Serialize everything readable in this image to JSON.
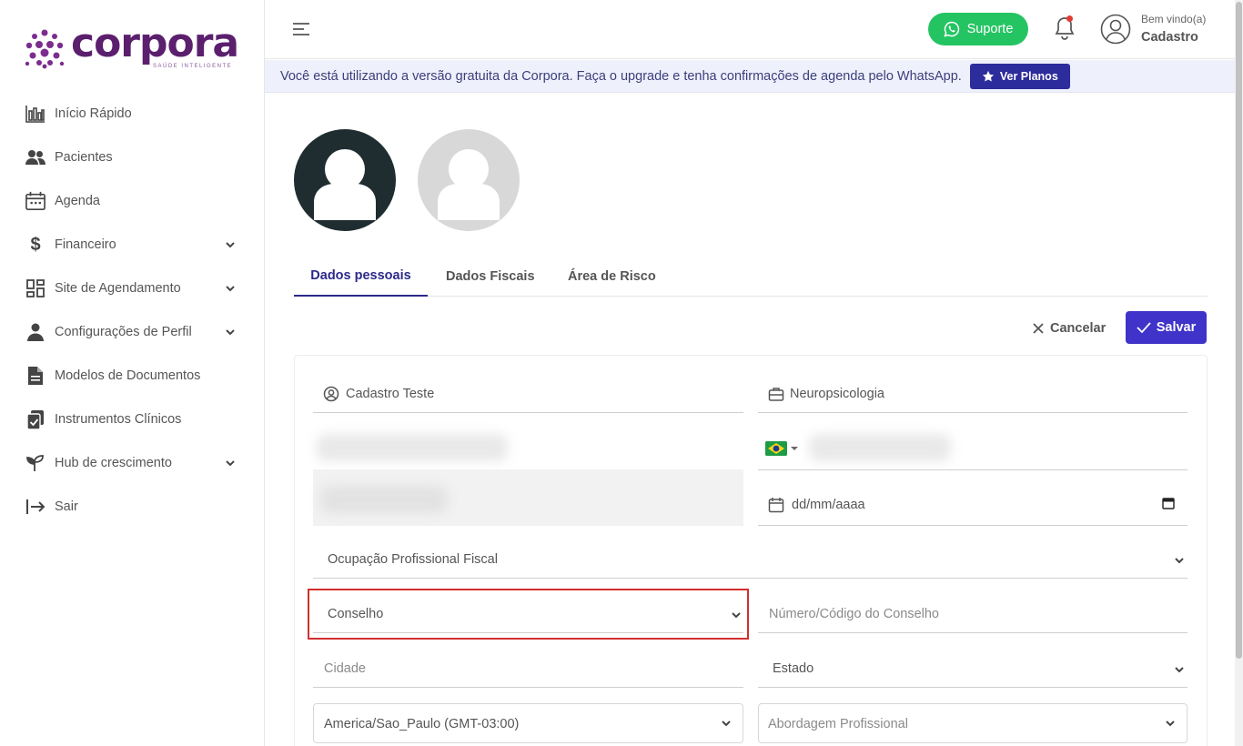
{
  "brand": {
    "name": "corpora",
    "tagline": "SAÚDE INTELIGENTE"
  },
  "sidebar": {
    "items": [
      {
        "label": "Início Rápido",
        "icon": "bar-chart-icon",
        "has_submenu": false
      },
      {
        "label": "Pacientes",
        "icon": "users-icon",
        "has_submenu": false
      },
      {
        "label": "Agenda",
        "icon": "calendar-icon",
        "has_submenu": false
      },
      {
        "label": "Financeiro",
        "icon": "dollar-icon",
        "has_submenu": true
      },
      {
        "label": "Site de Agendamento",
        "icon": "grid-icon",
        "has_submenu": true
      },
      {
        "label": "Configurações de Perfil",
        "icon": "person-icon",
        "has_submenu": true
      },
      {
        "label": "Modelos de Documentos",
        "icon": "document-icon",
        "has_submenu": false
      },
      {
        "label": "Instrumentos Clínicos",
        "icon": "clipboard-icon",
        "has_submenu": false
      },
      {
        "label": "Hub de crescimento",
        "icon": "sprout-icon",
        "has_submenu": true
      },
      {
        "label": "Sair",
        "icon": "logout-icon",
        "has_submenu": false
      }
    ]
  },
  "header": {
    "support_label": "Suporte",
    "welcome": "Bem vindo(a)",
    "username": "Cadastro",
    "notification_dot_color": "#e53935"
  },
  "banner": {
    "text": "Você está utilizando a versão gratuita da Corpora. Faça o upgrade e tenha confirmações de agenda pelo WhatsApp.",
    "button_label": "Ver Planos"
  },
  "tabs": [
    {
      "label": "Dados pessoais",
      "active": true
    },
    {
      "label": "Dados Fiscais",
      "active": false
    },
    {
      "label": "Área de Risco",
      "active": false
    }
  ],
  "actions": {
    "cancel_label": "Cancelar",
    "save_label": "Salvar"
  },
  "form": {
    "name_value": "Cadastro Teste",
    "specialty_value": "Neuropsicologia",
    "birthdate_placeholder": "dd/mm/aaaa",
    "occupation_placeholder": "Ocupação Profissional Fiscal",
    "council_placeholder": "Conselho",
    "council_number_placeholder": "Número/Código do Conselho",
    "city_placeholder": "Cidade",
    "state_placeholder": "Estado",
    "timezone_value": "America/Sao_Paulo (GMT-03:00)",
    "approach_placeholder": "Abordagem Profissional"
  },
  "colors": {
    "brand_purple": "#5b1f6e",
    "primary": "#3f33c9",
    "whatsapp_green": "#25c463",
    "highlight_red": "#d32f2f"
  }
}
